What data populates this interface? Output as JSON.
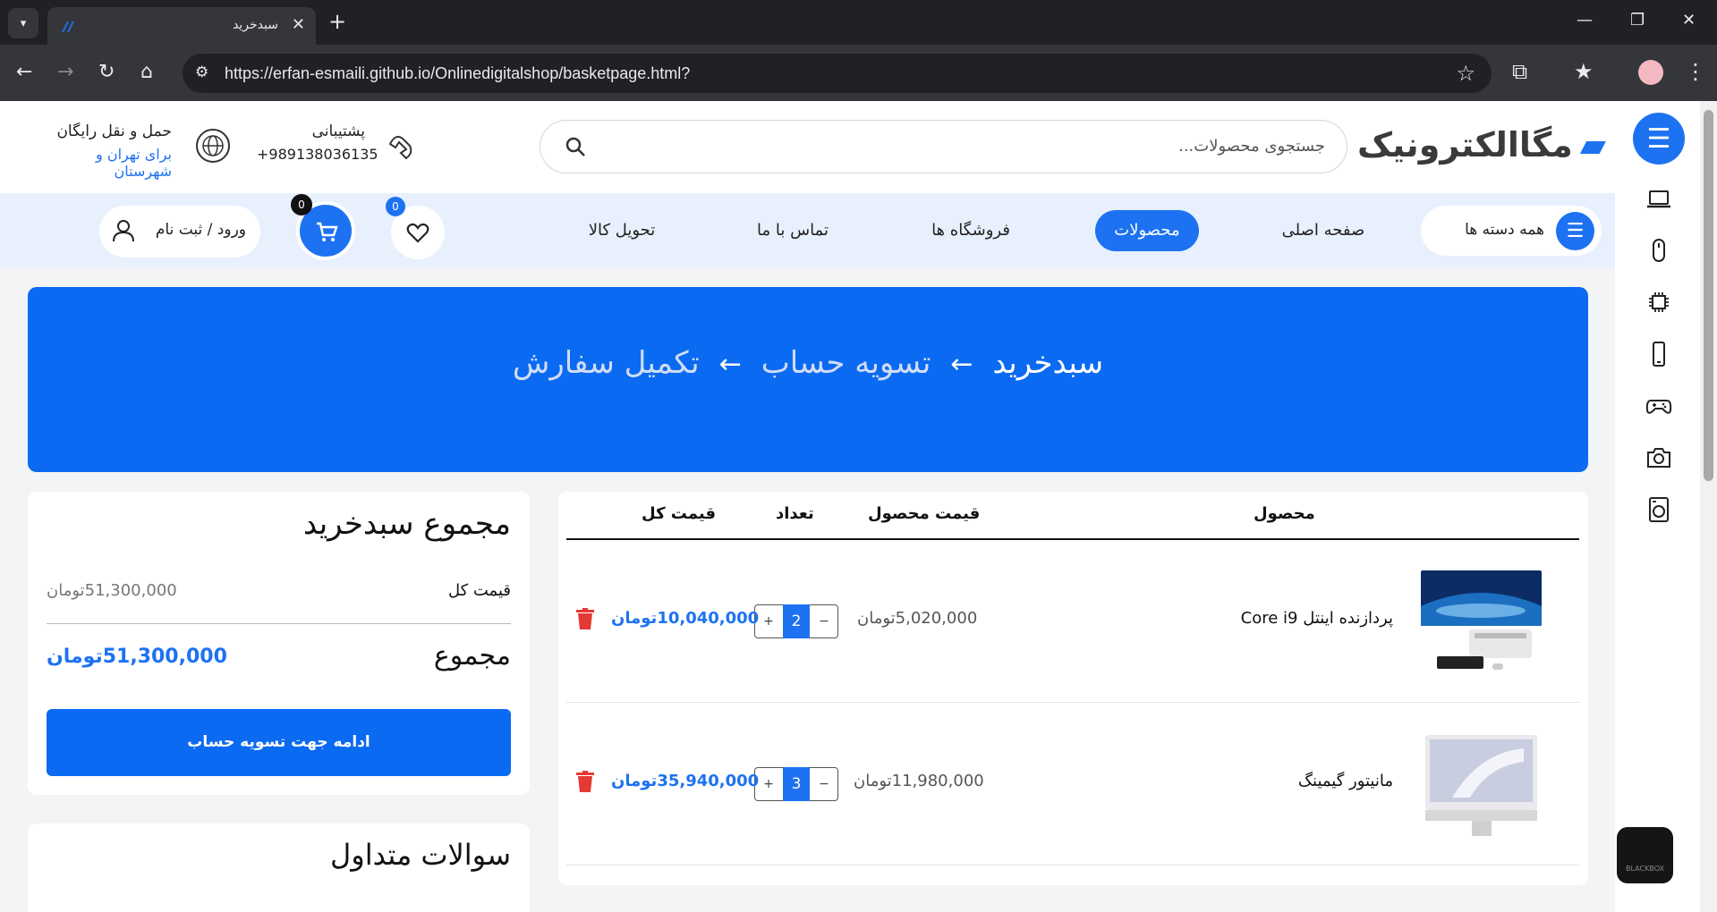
{
  "browser": {
    "tab_title": "سبدخرید",
    "url": "https://erfan-esmaili.github.io/Onlinedigitalshop/basketpage.html?"
  },
  "header": {
    "logo_text": "مگاالکترونیک",
    "search_placeholder": "جستجوی محصولات...",
    "support_title": "پشتیبانی",
    "support_phone": "+989138036135",
    "shipping_title": "حمل و نقل رایگان",
    "shipping_sub": "برای تهران و شهرستان"
  },
  "menu": {
    "all_categories": "همه دسته ها",
    "items": [
      "صفحه اصلی",
      "محصولات",
      "فروشگاه ها",
      "تماس با ما",
      "تحویل کالا"
    ],
    "active_index": 1,
    "wishlist_count": "0",
    "cart_count": "0",
    "login_label": "ورود / ثبت نام"
  },
  "hero": {
    "steps": [
      "سبدخرید",
      "تسویه حساب",
      "تکمیل سفارش"
    ]
  },
  "cart_table": {
    "headers": {
      "product": "محصول",
      "unit_price": "قیمت محصول",
      "quantity": "تعداد",
      "total": "قیمت کل"
    },
    "rows": [
      {
        "name": "پردازنده اینتل Core i9",
        "unit_price": "5,020,000تومان",
        "quantity": "2",
        "total": "10,040,000تومان",
        "image": "computer-set"
      },
      {
        "name": "مانیتور گیمینگ",
        "unit_price": "11,980,000تومان",
        "quantity": "3",
        "total": "35,940,000تومان",
        "image": "imac-monitor"
      }
    ]
  },
  "summary": {
    "title": "مجموع سبدخرید",
    "subtotal_label": "قیمت کل",
    "subtotal_value": "51,300,000تومان",
    "total_label": "مجموع",
    "total_value": "51,300,000تومان",
    "checkout_label": "ادامه جهت تسویه حساب"
  },
  "faq": {
    "title": "سوالات متداول"
  },
  "side_rail": {
    "icons": [
      "laptop-icon",
      "mouse-icon",
      "cpu-icon",
      "phone-icon",
      "gamepad-icon",
      "camera-icon",
      "washing-machine-icon"
    ]
  },
  "colors": {
    "accent": "#1d72f2",
    "hero": "#0a6af2",
    "danger": "#e53935"
  }
}
